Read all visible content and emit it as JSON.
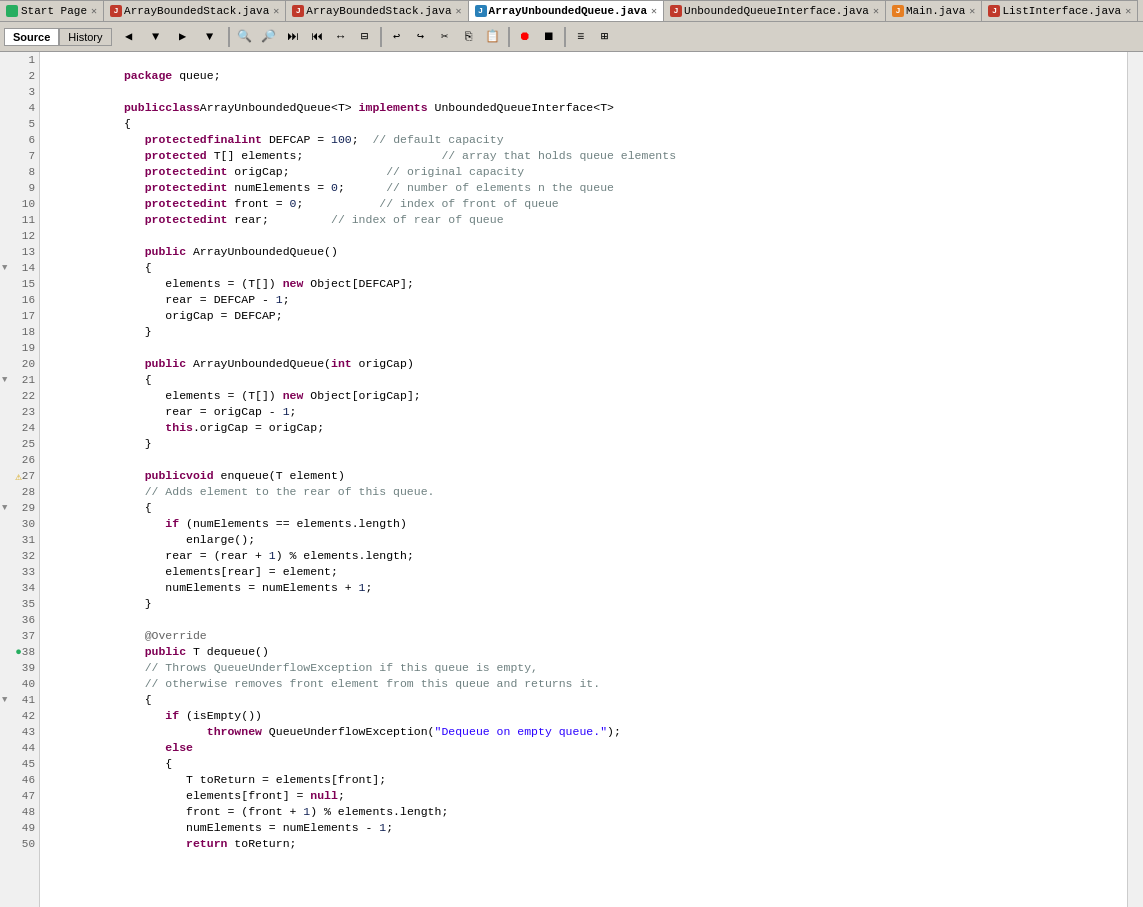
{
  "tabs": [
    {
      "label": "Start Page",
      "icon": "start",
      "active": false,
      "closable": true
    },
    {
      "label": "ArrayBoundedStack.java",
      "icon": "java-red",
      "active": false,
      "closable": true
    },
    {
      "label": "ArrayBoundedStack.java",
      "icon": "java-red",
      "active": false,
      "closable": true
    },
    {
      "label": "ArrayUnboundedQueue.java",
      "icon": "java-blue",
      "active": true,
      "closable": true
    },
    {
      "label": "UnboundedQueueInterface.java",
      "icon": "java-red",
      "active": false,
      "closable": true
    },
    {
      "label": "Main.java",
      "icon": "java-orange",
      "active": false,
      "closable": true
    },
    {
      "label": "ListInterface.java",
      "icon": "java-red",
      "active": false,
      "closable": true
    }
  ],
  "toolbar": {
    "source_btn": "Source",
    "history_btn": "History"
  },
  "code_lines": [
    {
      "num": 1,
      "content": "",
      "fold": false,
      "gutter": ""
    },
    {
      "num": 2,
      "content": "   package queue;",
      "fold": false,
      "gutter": ""
    },
    {
      "num": 3,
      "content": "",
      "fold": false,
      "gutter": ""
    },
    {
      "num": 4,
      "content": "   public class ArrayUnboundedQueue<T> implements UnboundedQueueInterface<T>",
      "fold": false,
      "gutter": ""
    },
    {
      "num": 5,
      "content": "   {",
      "fold": false,
      "gutter": ""
    },
    {
      "num": 6,
      "content": "      protected final int DEFCAP = 100;  // default capacity",
      "fold": false,
      "gutter": ""
    },
    {
      "num": 7,
      "content": "      protected T[] elements;                    // array that holds queue elements",
      "fold": false,
      "gutter": ""
    },
    {
      "num": 8,
      "content": "      protected int origCap;              // original capacity",
      "fold": false,
      "gutter": ""
    },
    {
      "num": 9,
      "content": "      protected int numElements = 0;      // number of elements n the queue",
      "fold": false,
      "gutter": ""
    },
    {
      "num": 10,
      "content": "      protected int front = 0;           // index of front of queue",
      "fold": false,
      "gutter": ""
    },
    {
      "num": 11,
      "content": "      protected int rear;         // index of rear of queue",
      "fold": false,
      "gutter": ""
    },
    {
      "num": 12,
      "content": "",
      "fold": false,
      "gutter": ""
    },
    {
      "num": 13,
      "content": "      public ArrayUnboundedQueue()",
      "fold": false,
      "gutter": ""
    },
    {
      "num": 14,
      "content": "      {",
      "fold": true,
      "gutter": ""
    },
    {
      "num": 15,
      "content": "         elements = (T[]) new Object[DEFCAP];",
      "fold": false,
      "gutter": ""
    },
    {
      "num": 16,
      "content": "         rear = DEFCAP - 1;",
      "fold": false,
      "gutter": ""
    },
    {
      "num": 17,
      "content": "         origCap = DEFCAP;",
      "fold": false,
      "gutter": ""
    },
    {
      "num": 18,
      "content": "      }",
      "fold": false,
      "gutter": ""
    },
    {
      "num": 19,
      "content": "",
      "fold": false,
      "gutter": ""
    },
    {
      "num": 20,
      "content": "      public ArrayUnboundedQueue(int origCap)",
      "fold": false,
      "gutter": ""
    },
    {
      "num": 21,
      "content": "      {",
      "fold": true,
      "gutter": ""
    },
    {
      "num": 22,
      "content": "         elements = (T[]) new Object[origCap];",
      "fold": false,
      "gutter": ""
    },
    {
      "num": 23,
      "content": "         rear = origCap - 1;",
      "fold": false,
      "gutter": ""
    },
    {
      "num": 24,
      "content": "         this.origCap = origCap;",
      "fold": false,
      "gutter": ""
    },
    {
      "num": 25,
      "content": "      }",
      "fold": false,
      "gutter": ""
    },
    {
      "num": 26,
      "content": "",
      "fold": false,
      "gutter": ""
    },
    {
      "num": 27,
      "content": "      public void enqueue(T element)",
      "fold": false,
      "gutter": "info"
    },
    {
      "num": 28,
      "content": "      // Adds element to the rear of this queue.",
      "fold": false,
      "gutter": ""
    },
    {
      "num": 29,
      "content": "      {",
      "fold": true,
      "gutter": ""
    },
    {
      "num": 30,
      "content": "         if (numElements == elements.length)",
      "fold": false,
      "gutter": ""
    },
    {
      "num": 31,
      "content": "            enlarge();",
      "fold": false,
      "gutter": ""
    },
    {
      "num": 32,
      "content": "         rear = (rear + 1) % elements.length;",
      "fold": false,
      "gutter": ""
    },
    {
      "num": 33,
      "content": "         elements[rear] = element;",
      "fold": false,
      "gutter": ""
    },
    {
      "num": 34,
      "content": "         numElements = numElements + 1;",
      "fold": false,
      "gutter": ""
    },
    {
      "num": 35,
      "content": "      }",
      "fold": false,
      "gutter": ""
    },
    {
      "num": 36,
      "content": "",
      "fold": false,
      "gutter": ""
    },
    {
      "num": 37,
      "content": "      @Override",
      "fold": false,
      "gutter": ""
    },
    {
      "num": 38,
      "content": "      public T dequeue()",
      "fold": false,
      "gutter": "override"
    },
    {
      "num": 39,
      "content": "      // Throws QueueUnderflowException if this queue is empty,",
      "fold": false,
      "gutter": ""
    },
    {
      "num": 40,
      "content": "      // otherwise removes front element from this queue and returns it.",
      "fold": false,
      "gutter": ""
    },
    {
      "num": 41,
      "content": "      {",
      "fold": true,
      "gutter": ""
    },
    {
      "num": 42,
      "content": "         if (isEmpty())",
      "fold": false,
      "gutter": ""
    },
    {
      "num": 43,
      "content": "               throw new QueueUnderflowException(\"Dequeue on empty queue.\");",
      "fold": false,
      "gutter": ""
    },
    {
      "num": 44,
      "content": "         else",
      "fold": false,
      "gutter": ""
    },
    {
      "num": 45,
      "content": "         {",
      "fold": false,
      "gutter": ""
    },
    {
      "num": 46,
      "content": "            T toReturn = elements[front];",
      "fold": false,
      "gutter": ""
    },
    {
      "num": 47,
      "content": "            elements[front] = null;",
      "fold": false,
      "gutter": ""
    },
    {
      "num": 48,
      "content": "            front = (front + 1) % elements.length;",
      "fold": false,
      "gutter": ""
    },
    {
      "num": 49,
      "content": "            numElements = numElements - 1;",
      "fold": false,
      "gutter": ""
    },
    {
      "num": 50,
      "content": "            return toReturn;",
      "fold": false,
      "gutter": ""
    }
  ]
}
